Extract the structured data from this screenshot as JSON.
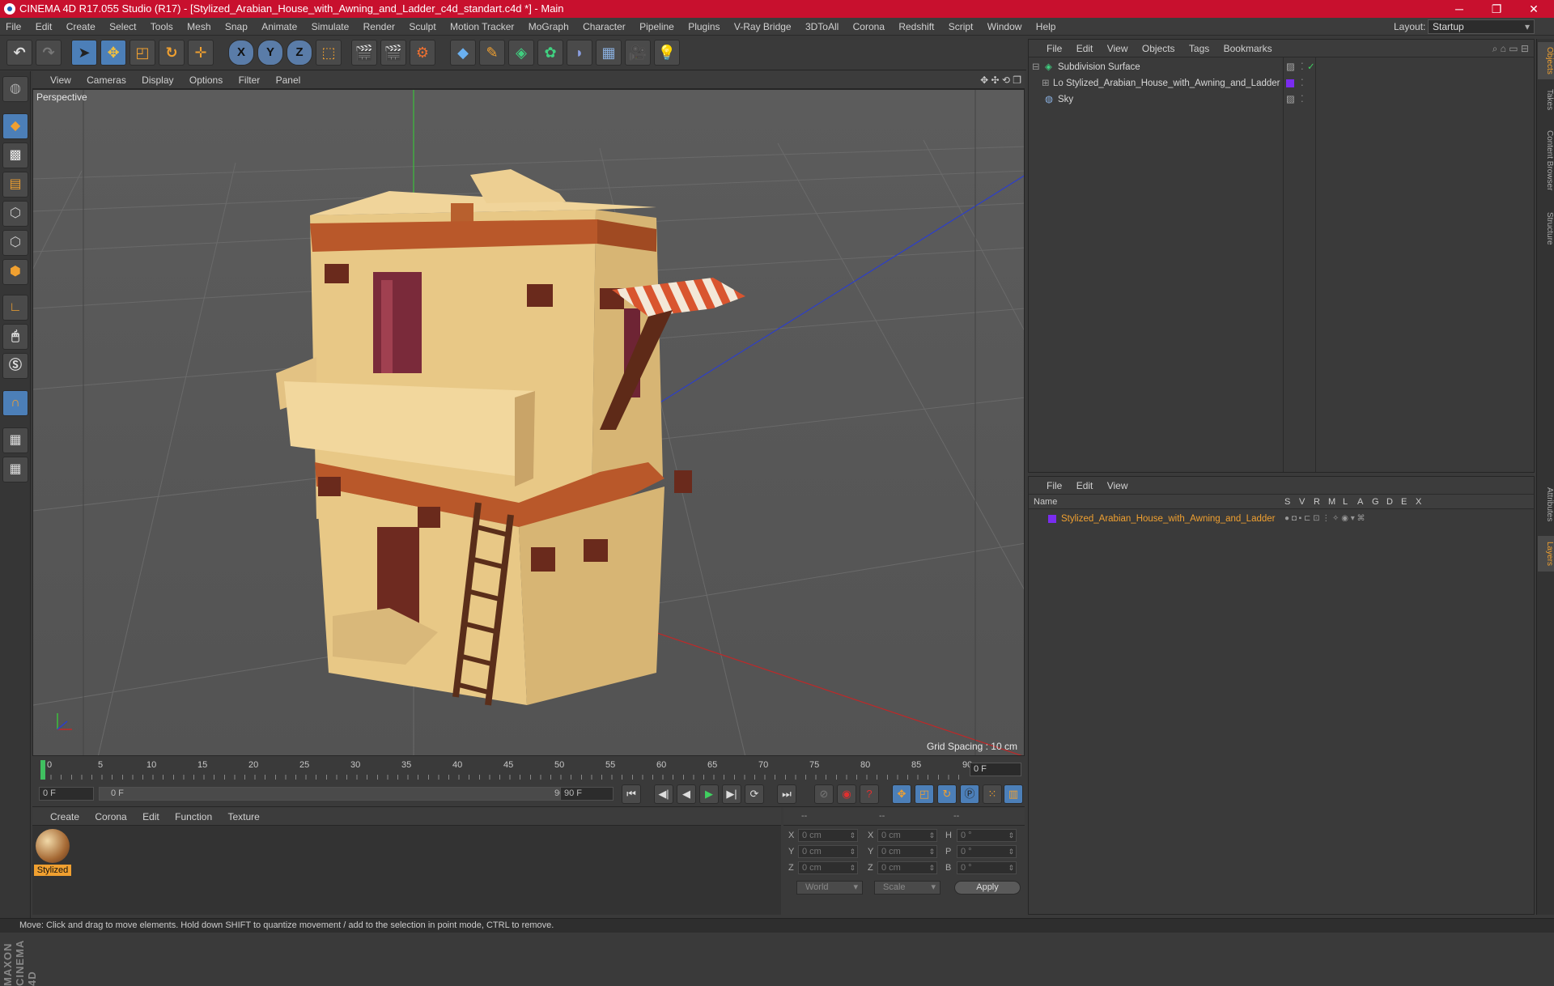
{
  "window": {
    "title": "CINEMA 4D R17.055 Studio (R17) - [Stylized_Arabian_House_with_Awning_and_Ladder_c4d_standart.c4d *] - Main",
    "minimize": "─",
    "maximize": "❐",
    "close": "✕"
  },
  "menubar": [
    "File",
    "Edit",
    "Create",
    "Select",
    "Tools",
    "Mesh",
    "Snap",
    "Animate",
    "Simulate",
    "Render",
    "Sculpt",
    "Motion Tracker",
    "MoGraph",
    "Character",
    "Pipeline",
    "Plugins",
    "V-Ray Bridge",
    "3DToAll",
    "Corona",
    "Redshift",
    "Script",
    "Window",
    "Help"
  ],
  "layout": {
    "label": "Layout:",
    "value": "Startup"
  },
  "viewport": {
    "menu": [
      "View",
      "Cameras",
      "Display",
      "Options",
      "Filter",
      "Panel"
    ],
    "label": "Perspective",
    "grid_spacing": "Grid Spacing : 10 cm"
  },
  "timeline": {
    "ticks": [
      "0",
      "5",
      "10",
      "15",
      "20",
      "25",
      "30",
      "35",
      "40",
      "45",
      "50",
      "55",
      "60",
      "65",
      "70",
      "75",
      "80",
      "85",
      "90"
    ],
    "current_frame": "0 F"
  },
  "playback": {
    "start": "0 F",
    "range_start": "0 F",
    "range_end": "90 F",
    "end": "90 F"
  },
  "material_manager": {
    "menu": [
      "Create",
      "Corona",
      "Edit",
      "Function",
      "Texture"
    ],
    "material_name": "Stylized"
  },
  "coordinates": {
    "header": [
      "--",
      "--",
      "--"
    ],
    "rows": [
      {
        "a": "X",
        "av": "0 cm",
        "b": "X",
        "bv": "0 cm",
        "c": "H",
        "cv": "0 °"
      },
      {
        "a": "Y",
        "av": "0 cm",
        "b": "Y",
        "bv": "0 cm",
        "c": "P",
        "cv": "0 °"
      },
      {
        "a": "Z",
        "av": "0 cm",
        "b": "Z",
        "bv": "0 cm",
        "c": "B",
        "cv": "0 °"
      }
    ],
    "space": "World",
    "mode": "Scale",
    "apply": "Apply"
  },
  "object_manager": {
    "menu": [
      "File",
      "Edit",
      "View",
      "Objects",
      "Tags",
      "Bookmarks"
    ],
    "objects": [
      {
        "name": "Subdivision Surface"
      },
      {
        "name": "Stylized_Arabian_House_with_Awning_and_Ladder"
      },
      {
        "name": "Sky"
      }
    ]
  },
  "layer_manager": {
    "menu": [
      "File",
      "Edit",
      "View"
    ],
    "columns": {
      "name": "Name",
      "flags": [
        "S",
        "V",
        "R",
        "M",
        "L",
        "A",
        "G",
        "D",
        "E",
        "X"
      ]
    },
    "layers": [
      {
        "name": "Stylized_Arabian_House_with_Awning_and_Ladder",
        "color": "#7a2cf0"
      }
    ]
  },
  "side_tabs": [
    "Objects",
    "Takes",
    "Content Browser",
    "Structure",
    "Attributes",
    "Layers"
  ],
  "status": "Move: Click and drag to move elements. Hold down SHIFT to quantize movement / add to the selection in point mode, CTRL to remove.",
  "colors": {
    "titlebar": "#c8102e",
    "accent": "#f0a030",
    "selection_blue": "#4c7fb8"
  }
}
